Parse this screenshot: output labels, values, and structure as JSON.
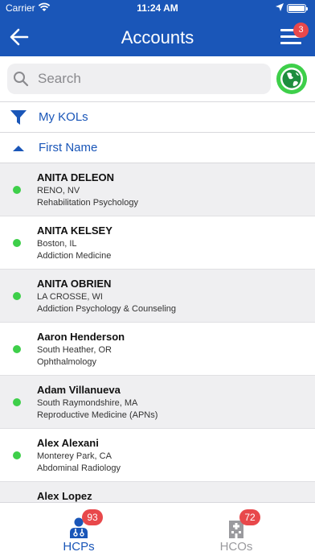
{
  "status_bar": {
    "carrier": "Carrier",
    "time": "11:24 AM"
  },
  "nav": {
    "title": "Accounts",
    "menu_badge": "3"
  },
  "search": {
    "placeholder": "Search"
  },
  "filters": {
    "kol_label": "My KOLs",
    "sort_label": "First Name"
  },
  "accounts": [
    {
      "name": "ANITA DELEON",
      "location": "RENO, NV",
      "specialty": "Rehabilitation Psychology"
    },
    {
      "name": "ANITA KELSEY",
      "location": "Boston, IL",
      "specialty": "Addiction Medicine"
    },
    {
      "name": "ANITA OBRIEN",
      "location": "LA CROSSE, WI",
      "specialty": "Addiction Psychology & Counseling"
    },
    {
      "name": "Aaron Henderson",
      "location": "South Heather, OR",
      "specialty": "Ophthalmology"
    },
    {
      "name": "Adam Villanueva",
      "location": "South Raymondshire, MA",
      "specialty": "Reproductive Medicine (APNs)"
    },
    {
      "name": "Alex Alexani",
      "location": "Monterey Park, CA",
      "specialty": "Abdominal Radiology"
    },
    {
      "name": "Alex Lopez",
      "location": "",
      "specialty": ""
    }
  ],
  "tabs": {
    "hcps": {
      "label": "HCPs",
      "badge": "93"
    },
    "hcos": {
      "label": "HCOs",
      "badge": "72"
    }
  },
  "colors": {
    "brand": "#1a56b8",
    "status_dot": "#3ecf4a",
    "badge": "#e8484b",
    "inactive_tab": "#9a9a9e"
  }
}
